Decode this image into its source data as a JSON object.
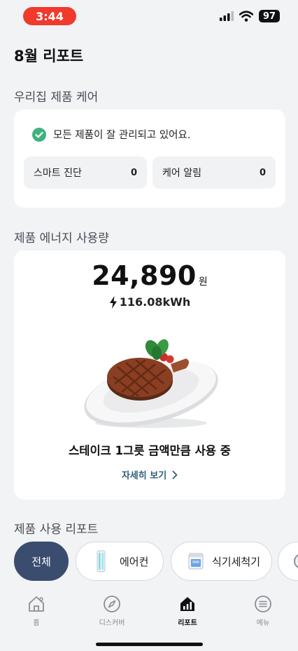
{
  "status_bar": {
    "time": "3:44",
    "battery": "97"
  },
  "page_title": "8월 리포트",
  "product_care": {
    "section_title": "우리집 제품 케어",
    "status_text": "모든 제품이 잘 관리되고 있어요.",
    "smart_diagnosis": {
      "label": "스마트 진단",
      "count": "0"
    },
    "care_alerts": {
      "label": "케어 알림",
      "count": "0"
    }
  },
  "energy": {
    "section_title": "제품 에너지 사용량",
    "cost": "24,890",
    "cost_unit": "원",
    "usage": "116.08kWh",
    "caption": "스테이크 1그릇 금액만큼 사용 중",
    "detail_link": "자세히 보기"
  },
  "product_report": {
    "section_title": "제품 사용 리포트",
    "chips": [
      {
        "label": "전체",
        "active": true
      },
      {
        "label": "에어컨",
        "icon": "air-conditioner-icon"
      },
      {
        "label": "식기세척기",
        "icon": "dishwasher-icon"
      }
    ]
  },
  "bottom_nav": [
    {
      "label": "홈",
      "icon": "home-icon"
    },
    {
      "label": "디스커버",
      "icon": "compass-icon"
    },
    {
      "label": "리포트",
      "icon": "report-icon",
      "active": true
    },
    {
      "label": "메뉴",
      "icon": "menu-icon"
    }
  ],
  "colors": {
    "active_chip": "#3b4d6e",
    "check": "#3fb27f",
    "link": "#2e5f78",
    "time_pill": "#f03a2e"
  }
}
